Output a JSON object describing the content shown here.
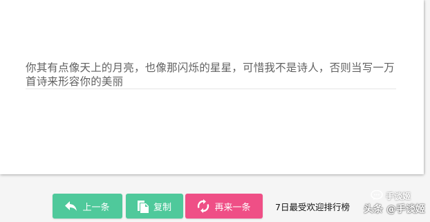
{
  "quote": {
    "text": "你其有点像天上的月亮，也像那闪烁的星星，可惜我不是诗人，否则当写一万首诗来形容你的美丽"
  },
  "toolbar": {
    "prev_label": "上一条",
    "copy_label": "复制",
    "next_label": "再来一条",
    "ranking_label": "7日最受欢迎排行榜"
  },
  "watermark": {
    "top_text": "手谈姬",
    "bottom_text": "头条 @手谈姬"
  },
  "colors": {
    "green": "#4fc99b",
    "pink": "#ef4f86",
    "text": "#616161"
  },
  "icons": {
    "prev": "reply-arrow-icon",
    "copy": "copy-icon",
    "next": "refresh-icon"
  }
}
